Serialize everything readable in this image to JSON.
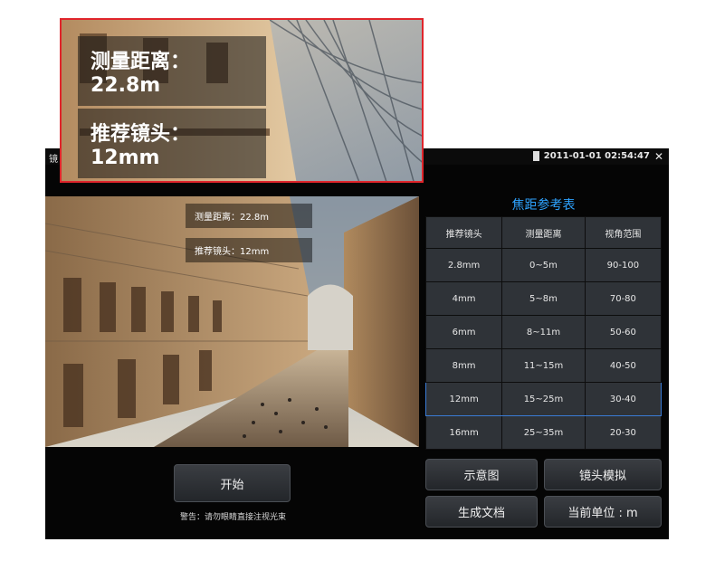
{
  "status": {
    "app_title": "镜",
    "datetime": "2011-01-01 02:54:47"
  },
  "zoom_callout": {
    "distance_text": "测量距离：22.8m",
    "lens_text": "推荐镜头：12mm"
  },
  "overlay": {
    "distance_text": "测量距离：22.8m",
    "lens_text": "推荐镜头：12mm"
  },
  "reference": {
    "title": "焦距参考表",
    "headers": [
      "推荐镜头",
      "测量距离",
      "视角范围"
    ],
    "rows": [
      [
        "2.8mm",
        "0~5m",
        "90-100"
      ],
      [
        "4mm",
        "5~8m",
        "70-80"
      ],
      [
        "6mm",
        "8~11m",
        "50-60"
      ],
      [
        "8mm",
        "11~15m",
        "40-50"
      ],
      [
        "12mm",
        "15~25m",
        "30-40"
      ],
      [
        "16mm",
        "25~35m",
        "20-30"
      ]
    ],
    "selected_row": 4,
    "selected_color": "#3a7bd5"
  },
  "buttons": {
    "start": "开始",
    "diagram": "示意图",
    "lens_sim": "镜头模拟",
    "generate_doc": "生成文档",
    "unit": "当前单位 : m"
  },
  "warning": "警告：请勿眼睛直接注视光束",
  "colors": {
    "title_accent": "#2ea3ff",
    "callout_border": "#e0252b"
  }
}
